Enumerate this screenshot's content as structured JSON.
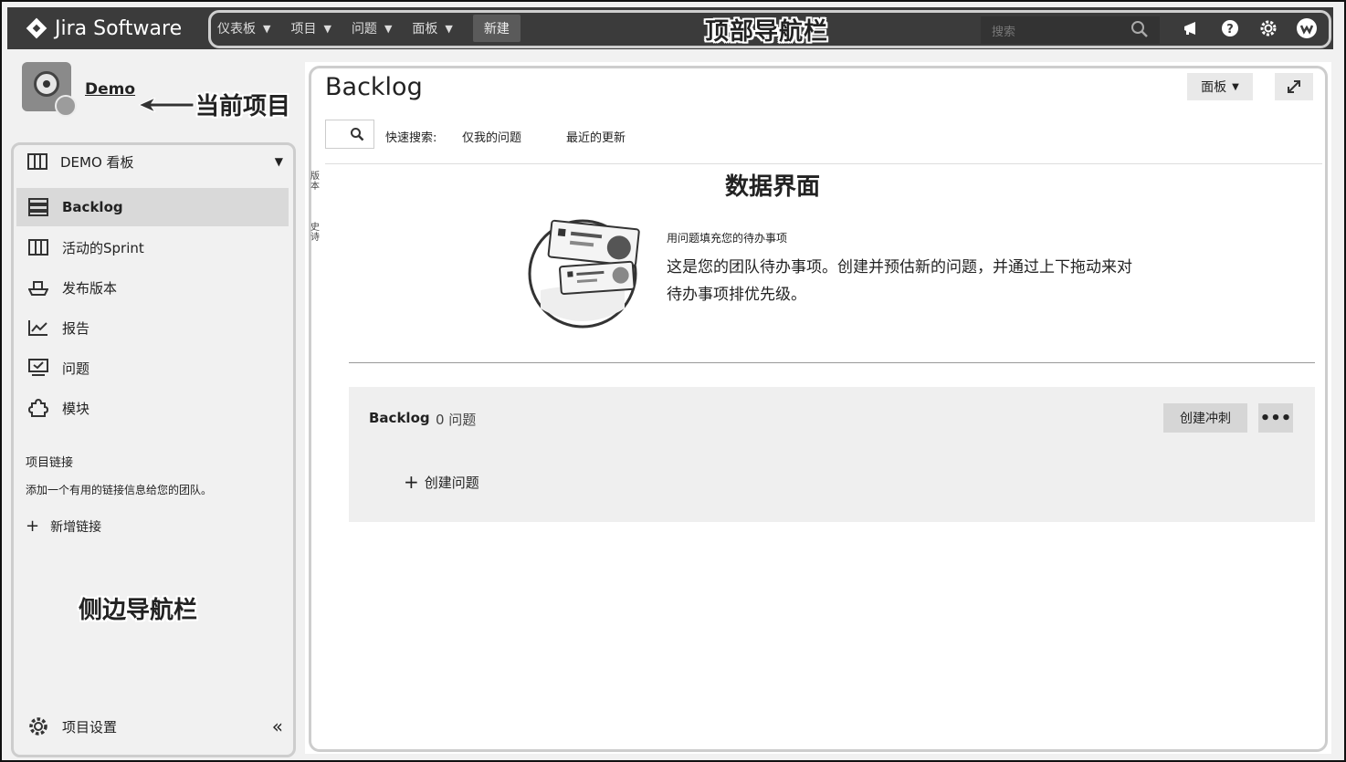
{
  "app": {
    "logo_text": "Jira Software"
  },
  "topnav": {
    "items": [
      {
        "label": "仪表板"
      },
      {
        "label": "项目"
      },
      {
        "label": "问题"
      },
      {
        "label": "面板"
      }
    ],
    "new_label": "新建",
    "search_placeholder": "搜索",
    "annotation": "顶部导航栏"
  },
  "project": {
    "name": "Demo",
    "annotation": "当前项目"
  },
  "sidebar": {
    "board_label": "DEMO 看板",
    "items": [
      {
        "label": "Backlog",
        "icon": "backlog-icon",
        "active": true
      },
      {
        "label": "活动的Sprint",
        "icon": "board-icon"
      },
      {
        "label": "发布版本",
        "icon": "ship-icon"
      },
      {
        "label": "报告",
        "icon": "chart-icon"
      },
      {
        "label": "问题",
        "icon": "issues-icon"
      },
      {
        "label": "模块",
        "icon": "puzzle-icon"
      }
    ],
    "links_heading": "项目链接",
    "links_desc": "添加一个有用的链接信息给您的团队。",
    "add_link": "新增链接",
    "annotation": "侧边导航栏",
    "settings_label": "项目设置"
  },
  "main": {
    "title": "Backlog",
    "board_button": "面板",
    "quick_search_label": "快速搜索:",
    "quick_filters": [
      "仅我的问题",
      "最近的更新"
    ],
    "side_tabs": [
      "版本",
      "史诗"
    ],
    "annotation": "数据界面",
    "empty_heading": "用问题填充您的待办事项",
    "empty_desc": "这是您的团队待办事项。创建并预估新的问题，并通过上下拖动来对待办事项排优先级。",
    "backlog": {
      "title": "Backlog",
      "count": "0 问题",
      "create_sprint": "创建冲刺",
      "more": "•••",
      "create_issue": "创建问题"
    }
  },
  "colors": {
    "topbar": "#3b3b3b",
    "active_item": "#d9d9d9",
    "panel": "#efefef"
  }
}
